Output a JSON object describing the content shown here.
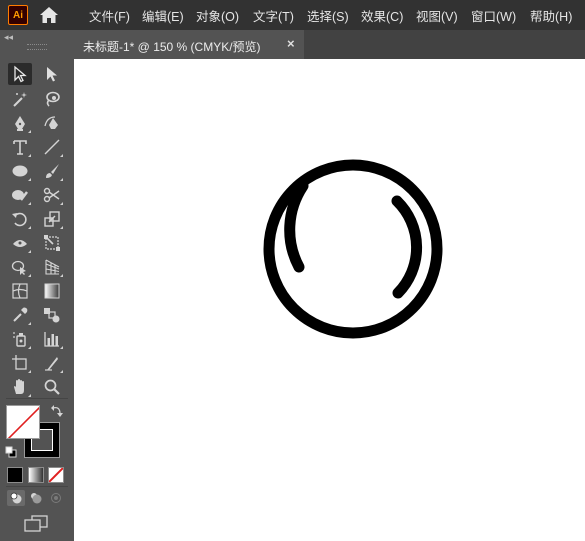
{
  "app": {
    "logo_text": "Ai"
  },
  "menu": [
    {
      "label": "文件(F)"
    },
    {
      "label": "编辑(E)"
    },
    {
      "label": "对象(O)"
    },
    {
      "label": "文字(T)"
    },
    {
      "label": "选择(S)"
    },
    {
      "label": "效果(C)"
    },
    {
      "label": "视图(V)"
    },
    {
      "label": "窗口(W)"
    },
    {
      "label": "帮助(H)"
    }
  ],
  "toolbar": {
    "collapse_glyph": "◂◂",
    "tools": [
      {
        "icon": "selection-arrow-icon",
        "active": true
      },
      {
        "icon": "direct-selection-icon"
      },
      {
        "icon": "magic-wand-icon"
      },
      {
        "icon": "lasso-icon"
      },
      {
        "icon": "pen-icon"
      },
      {
        "icon": "curvature-icon"
      },
      {
        "icon": "type-icon",
        "glyph": "T"
      },
      {
        "icon": "line-segment-icon"
      },
      {
        "icon": "ellipse-icon"
      },
      {
        "icon": "paintbrush-icon"
      },
      {
        "icon": "shaper-icon"
      },
      {
        "icon": "scissors-icon"
      },
      {
        "icon": "rotate-icon"
      },
      {
        "icon": "scale-icon"
      },
      {
        "icon": "width-icon"
      },
      {
        "icon": "free-transform-icon"
      },
      {
        "icon": "shape-builder-icon"
      },
      {
        "icon": "perspective-grid-icon"
      },
      {
        "icon": "mesh-icon"
      },
      {
        "icon": "gradient-icon"
      },
      {
        "icon": "eyedropper-icon"
      },
      {
        "icon": "blend-icon"
      },
      {
        "icon": "symbol-sprayer-icon"
      },
      {
        "icon": "column-graph-icon"
      },
      {
        "icon": "artboard-icon"
      },
      {
        "icon": "slice-icon"
      },
      {
        "icon": "hand-icon"
      },
      {
        "icon": "zoom-icon"
      }
    ],
    "fill_color": "#ffffff",
    "stroke_color": "#000000",
    "none_indicator_color": "#e02020"
  },
  "document_tab": {
    "title": "未标题-1* @ 150 % (CMYK/预览)",
    "close_glyph": "×"
  },
  "colors": {
    "menubar_bg": "#323232",
    "panel_bg": "#535353",
    "canvas_bg": "#ffffff",
    "art_stroke": "#000000",
    "logo_accent": "#ff9a00"
  }
}
